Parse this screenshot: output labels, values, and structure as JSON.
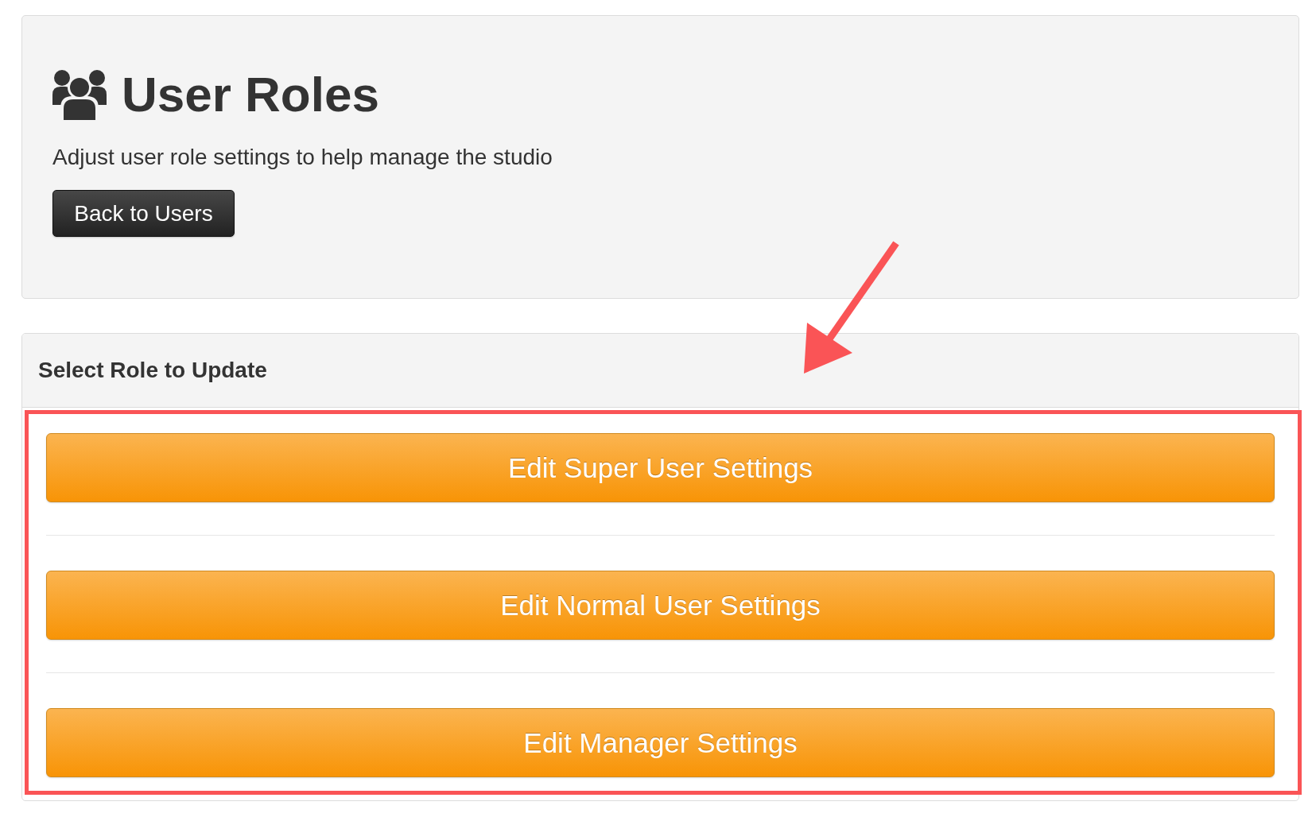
{
  "header": {
    "title": "User Roles",
    "subtitle": "Adjust user role settings to help manage the studio",
    "back_button": "Back to Users"
  },
  "role_panel": {
    "heading": "Select Role to Update",
    "buttons": [
      "Edit Super User Settings",
      "Edit Normal User Settings",
      "Edit Manager Settings"
    ]
  },
  "annotations": {
    "arrow": true,
    "highlight_frame": true
  }
}
